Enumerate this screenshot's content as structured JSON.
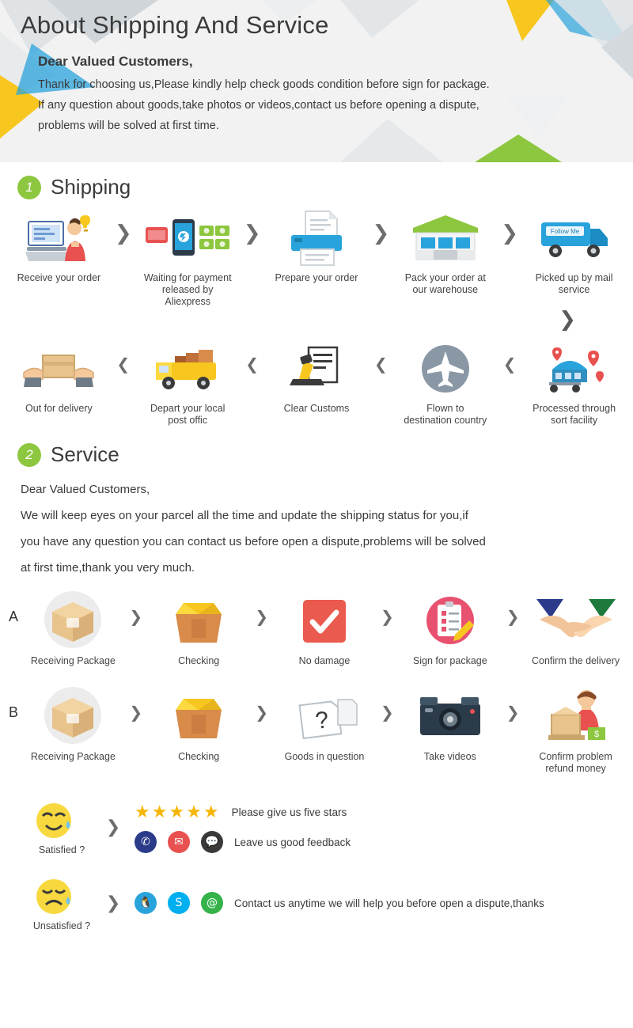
{
  "header": {
    "title": "About Shipping And Service",
    "subtitle": "Dear Valued Customers,",
    "lines": [
      "Thank for choosing us,Please kindly help check goods condition before sign for package.",
      "If any question about goods,take photos or videos,contact us before opening a dispute,",
      "problems will be solved at first time."
    ]
  },
  "sections": {
    "shipping": {
      "number": "1",
      "title": "Shipping"
    },
    "service": {
      "number": "2",
      "title": "Service"
    }
  },
  "shipping_row1": [
    {
      "icon": "desk-computer-icon",
      "label": "Receive your order"
    },
    {
      "icon": "phone-money-icon",
      "label": "Waiting for payment\nreleased by Aliexpress"
    },
    {
      "icon": "printer-icon",
      "label": "Prepare your order"
    },
    {
      "icon": "warehouse-icon",
      "label": "Pack your order at\nour warehouse"
    },
    {
      "icon": "mail-truck-icon",
      "label": "Picked up by mail service"
    }
  ],
  "shipping_row2": [
    {
      "icon": "delivery-hands-icon",
      "label": "Out for delivery"
    },
    {
      "icon": "post-truck-icon",
      "label": "Depart your local\npost offic"
    },
    {
      "icon": "customs-stamp-icon",
      "label": "Clear Customs"
    },
    {
      "icon": "airplane-icon",
      "label": "Flown to\ndestination country"
    },
    {
      "icon": "sort-facility-icon",
      "label": "Processed through\nsort facility"
    }
  ],
  "service_rowA": {
    "tag": "A",
    "items": [
      {
        "icon": "package-box-icon",
        "label": "Receiving Package"
      },
      {
        "icon": "open-box-icon",
        "label": "Checking"
      },
      {
        "icon": "check-square-icon",
        "label": "No damage"
      },
      {
        "icon": "sign-clipboard-icon",
        "label": "Sign for package"
      },
      {
        "icon": "handshake-icon",
        "label": "Confirm the delivery"
      }
    ]
  },
  "service_rowB": {
    "tag": "B",
    "items": [
      {
        "icon": "package-box-icon",
        "label": "Receiving Package"
      },
      {
        "icon": "open-box-icon",
        "label": "Checking"
      },
      {
        "icon": "question-box-icon",
        "label": "Goods in question"
      },
      {
        "icon": "camera-icon",
        "label": "Take videos"
      },
      {
        "icon": "refund-person-icon",
        "label": "Confirm problem\nrefund money"
      }
    ]
  },
  "service_text": {
    "greeting": "Dear Valued Customers,",
    "lines": [
      "We will keep eyes on your parcel all the time and update the shipping status for you,if",
      "you have any question you can contact us before open a dispute,problems will be solved",
      "at first time,thank you very much."
    ]
  },
  "feedback": {
    "satisfied": {
      "face": "satisfied-face-icon",
      "label": "Satisfied ?",
      "stars": "★★★★★",
      "star_text": "Please give us five stars",
      "contact_text": "Leave us good feedback",
      "contact_icons": [
        "phone-icon",
        "mail-icon",
        "chat-icon"
      ]
    },
    "unsatisfied": {
      "face": "unsatisfied-face-icon",
      "label": "Unsatisfied ?",
      "text": "Contact us anytime we will help you before open a dispute,thanks",
      "contact_icons": [
        "qq-icon",
        "skype-icon",
        "email-at-icon"
      ]
    }
  },
  "colors": {
    "badge_green": "#8dc63f",
    "header_bg": "#f2f2f2",
    "star_yellow": "#f5b60a",
    "text_dark": "#3a3a3a"
  }
}
